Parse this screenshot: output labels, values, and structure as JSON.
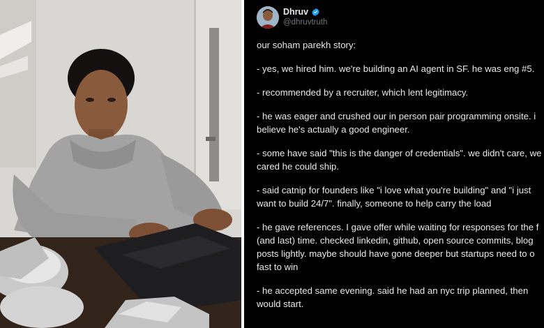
{
  "tweet": {
    "author": {
      "name": "Dhruv",
      "handle": "@dhruvtruth",
      "verified": true,
      "verified_color": "#1d9bf0"
    },
    "paragraphs": [
      {
        "lines": [
          "our soham parekh story:"
        ]
      },
      {
        "lines": [
          "- yes, we hired him. we're building an AI agent in SF. he was eng #5."
        ]
      },
      {
        "lines": [
          "- recommended by a recruiter, which lent legitimacy."
        ]
      },
      {
        "lines": [
          "- he was eager and crushed our in person pair programming onsite. i",
          "believe he's actually a good engineer."
        ]
      },
      {
        "lines": [
          "- some have said \"this is the danger of credentials\". we didn't care, we",
          "cared he could ship."
        ]
      },
      {
        "lines": [
          "- said catnip for founders like \"i love what you're building\" and \"i just",
          "want to build 24/7\". finally, someone to help carry the load"
        ]
      },
      {
        "lines": [
          "- he gave references. I gave offer while waiting for responses for the f",
          "(and last) time. checked linkedin, github, open source commits, blog",
          "posts lightly. maybe should have gone deeper but startups need to o",
          "fast to win"
        ]
      },
      {
        "lines": [
          "- he accepted same evening. said he had an nyc trip planned, then",
          "would start."
        ]
      }
    ]
  },
  "photo": {
    "subject": "young man in grey hoodie typing on a laptop",
    "colors": {
      "wall": "#dcdad6",
      "hoodie": "#a3a3a3",
      "skin": "#8a5a3c",
      "hair": "#141010",
      "laptop": "#1e1e20",
      "table": "#3a2a20"
    }
  }
}
